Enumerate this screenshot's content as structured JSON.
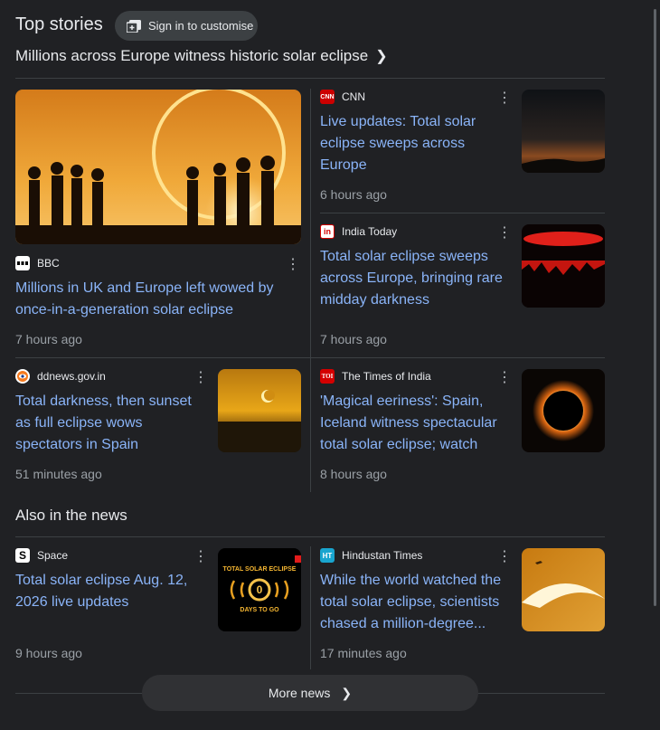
{
  "section_title": "Top stories",
  "signin_label": "Sign in to customise",
  "headline": "Millions across Europe witness historic solar eclipse",
  "also_title": "Also in the news",
  "more_label": "More news",
  "stories": [
    {
      "source": "BBC",
      "title": "Millions in UK and Europe left wowed by once-in-a-generation solar eclipse",
      "time": "7 hours ago"
    },
    {
      "source": "CNN",
      "logo_text": "CNN",
      "title": "Live updates: Total solar eclipse sweeps across Europe",
      "time": "6 hours ago"
    },
    {
      "source": "India Today",
      "logo_text": "in",
      "title": "Total solar eclipse sweeps across Europe, bringing rare midday darkness",
      "time": "7 hours ago"
    },
    {
      "source": "ddnews.gov.in",
      "title": "Total darkness, then sunset as full eclipse wows spectators in Spain",
      "time": "51 minutes ago"
    },
    {
      "source": "The Times of India",
      "logo_text": "TOI",
      "title": "'Magical eeriness': Spain, Iceland witness spectacular total solar eclipse; watch",
      "time": "8 hours ago"
    },
    {
      "source": "Space",
      "logo_text": "S",
      "title": "Total solar eclipse Aug. 12, 2026 live updates",
      "time": "9 hours ago",
      "thumb_text": {
        "top": "TOTAL SOLAR ECLIPSE",
        "count": "0",
        "bottom": "DAYS TO GO"
      }
    },
    {
      "source": "Hindustan Times",
      "logo_text": "HT",
      "title": "While the world watched the total solar eclipse, scientists chased a million-degree...",
      "time": "17 minutes ago"
    }
  ],
  "colors": {
    "background": "#202124",
    "link": "#8ab4f8",
    "muted": "#9aa0a6",
    "chip": "#3c4043"
  },
  "icons": {
    "signin": "newspaper-plus-icon",
    "chevron": "chevron-right-icon",
    "menu": "more-vert-icon"
  }
}
